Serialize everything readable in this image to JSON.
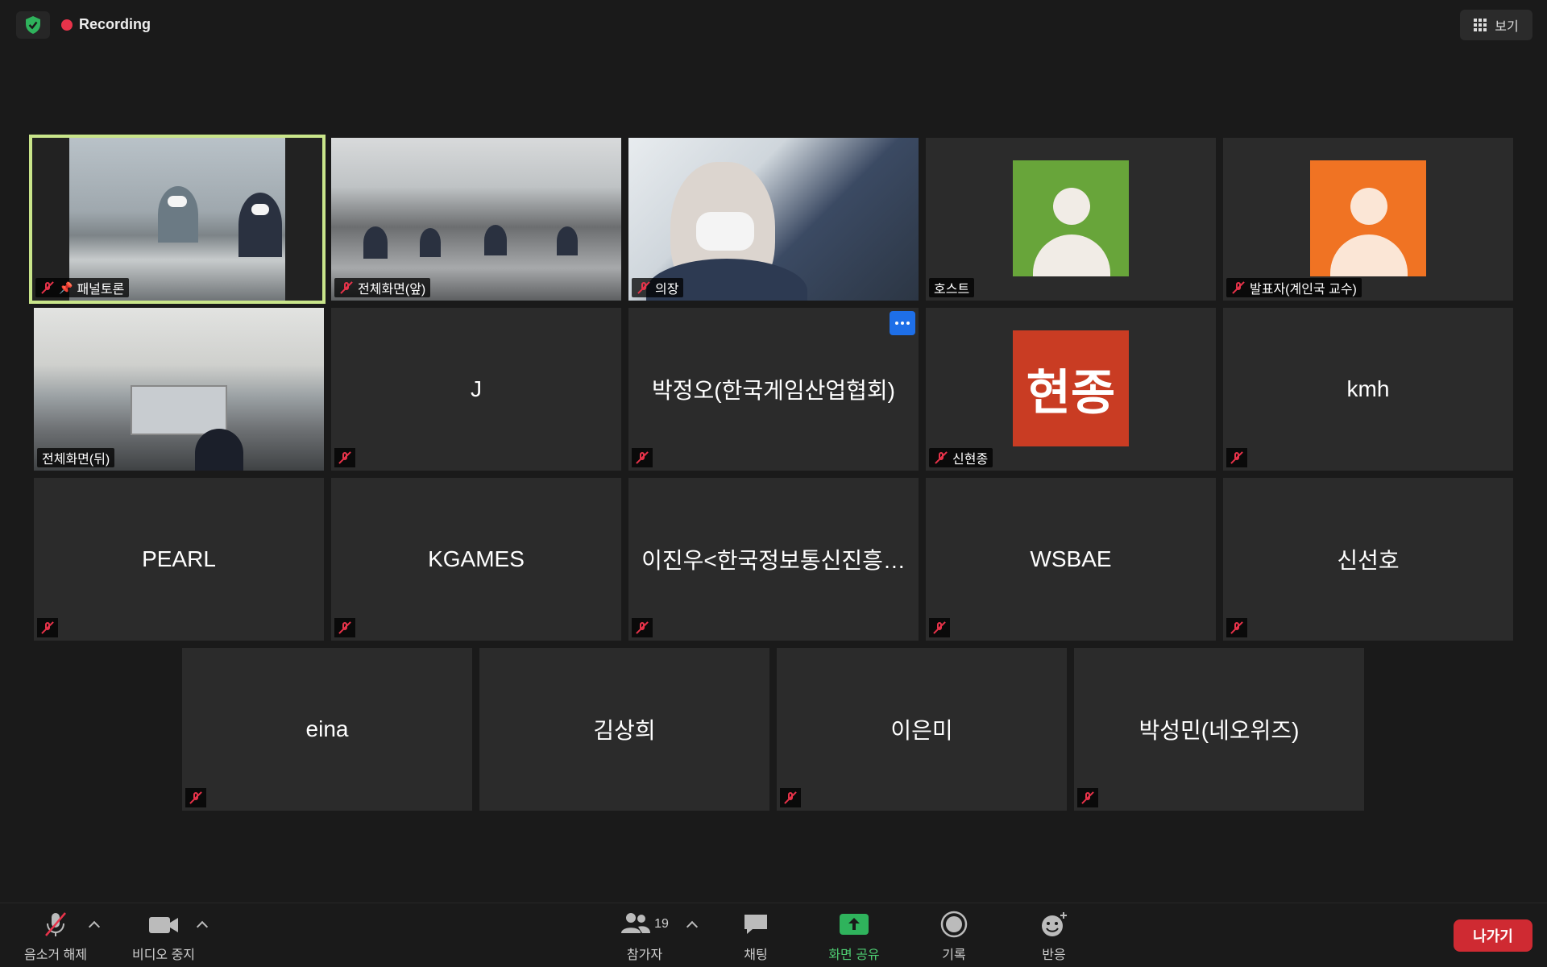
{
  "topbar": {
    "recording_label": "Recording",
    "view_label": "보기",
    "accent_color": "#e8334a",
    "security_color": "#2fb35c"
  },
  "tiles": [
    {
      "name": "패널토론",
      "type": "video",
      "muted": true,
      "pinned": true,
      "active": true
    },
    {
      "name": "전체화면(앞)",
      "type": "video",
      "muted": true
    },
    {
      "name": "의장",
      "type": "video",
      "muted": true
    },
    {
      "name": "호스트",
      "type": "avatar",
      "avatar_color": "#68a53a",
      "muted": false
    },
    {
      "name": "발표자(계인국 교수)",
      "type": "avatar",
      "avatar_color": "#f07323",
      "muted": true
    },
    {
      "name": "전체화면(뒤)",
      "type": "video",
      "muted": false
    },
    {
      "name": "J",
      "type": "name",
      "muted": true
    },
    {
      "name": "박정오(한국게임산업협회)",
      "type": "name",
      "muted": true,
      "has_more_button": true
    },
    {
      "name": "신현종",
      "type": "text-avatar",
      "avatar_text": "현종",
      "avatar_color": "#c93c23",
      "muted": true
    },
    {
      "name": "kmh",
      "type": "name",
      "muted": true
    },
    {
      "name": "PEARL",
      "type": "name",
      "muted": true
    },
    {
      "name": "KGAMES",
      "type": "name",
      "muted": true
    },
    {
      "name": "이진우<한국정보통신진흥…",
      "type": "name",
      "muted": true
    },
    {
      "name": "WSBAE",
      "type": "name",
      "muted": true
    },
    {
      "name": "신선호",
      "type": "name",
      "muted": true
    },
    {
      "name": "eina",
      "type": "name",
      "muted": true
    },
    {
      "name": "김상희",
      "type": "name",
      "muted": false
    },
    {
      "name": "이은미",
      "type": "name",
      "muted": true
    },
    {
      "name": "박성민(네오위즈)",
      "type": "name",
      "muted": true
    }
  ],
  "toolbar": {
    "unmute_label": "음소거 해제",
    "stop_video_label": "비디오 중지",
    "participants_label": "참가자",
    "participants_count": "19",
    "chat_label": "채팅",
    "share_label": "화면 공유",
    "record_label": "기록",
    "reactions_label": "반응",
    "leave_label": "나가기",
    "share_color": "#2fb35c",
    "leave_color": "#cf2a32"
  }
}
